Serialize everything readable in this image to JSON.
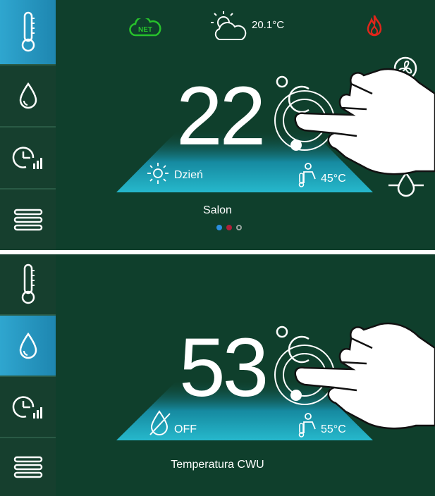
{
  "screens": [
    {
      "sidebar": [
        {
          "name": "thermometer-icon",
          "active": true
        },
        {
          "name": "water-drop-icon",
          "active": false
        },
        {
          "name": "clock-chart-icon",
          "active": false
        },
        {
          "name": "menu-icon",
          "active": false
        }
      ],
      "net_label": "NET",
      "weather_temp": "20.1°C",
      "big_temp": "22",
      "unit": "°C",
      "mode_label": "Dzień",
      "secondary_temp": "45°C",
      "zone_name": "Salon",
      "pager": {
        "count": 3,
        "active": 0,
        "colors": [
          "#2b8fe0",
          "#b0203a",
          "#9aa6a0"
        ]
      }
    },
    {
      "sidebar": [
        {
          "name": "thermometer-icon",
          "active": false
        },
        {
          "name": "water-drop-icon",
          "active": true
        },
        {
          "name": "clock-chart-icon",
          "active": false
        },
        {
          "name": "menu-icon",
          "active": false
        }
      ],
      "big_temp": "53",
      "unit": "°C",
      "mode_label": "OFF",
      "secondary_temp": "55°C",
      "zone_name": "Temperatura CWU"
    }
  ],
  "colors": {
    "background": "#0f3f2c",
    "sidebar_active": "#2fa6cf",
    "net_green": "#27c22b",
    "flame_red": "#e0261b",
    "trapezoid": "#1ea7c0"
  }
}
